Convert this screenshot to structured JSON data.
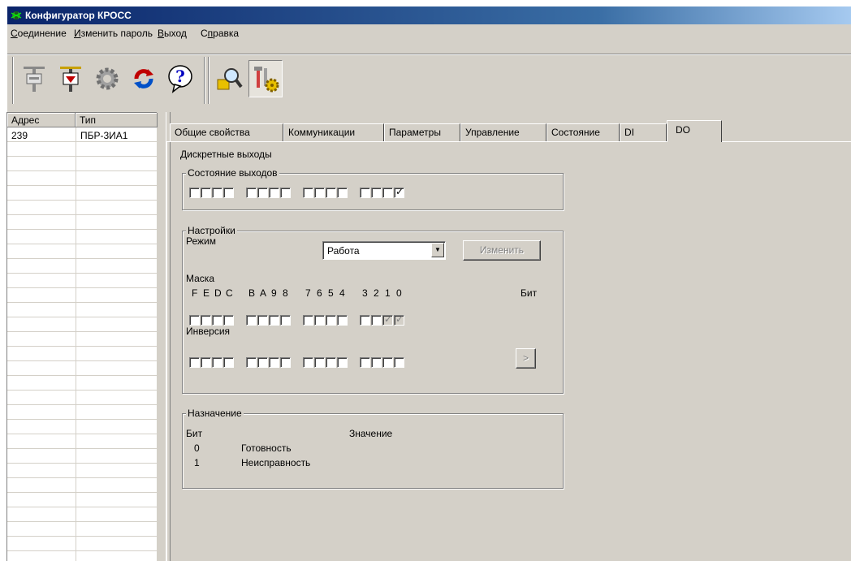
{
  "window": {
    "title": "Конфигуратор КРОСС"
  },
  "menu": [
    {
      "label": "Соединение",
      "underline": "С",
      "rest": "оединение"
    },
    {
      "label": "Изменить пароль",
      "underline": "И",
      "rest": "зменить пароль"
    },
    {
      "label": "Выход",
      "underline": "В",
      "rest": "ыход"
    },
    {
      "label": "Справка",
      "underline": "п",
      "prefix": "С",
      "rest": "равка"
    }
  ],
  "toolbar": {
    "buttons": [
      "connect-icon",
      "disconnect-icon",
      "settings-gear-icon",
      "refresh-icon",
      "help-icon",
      "search-device-icon",
      "tools-config-icon"
    ]
  },
  "device_list": {
    "columns": [
      "Адрес",
      "Тип"
    ],
    "rows": [
      {
        "address": "239",
        "type": "ПБР-3ИА1"
      }
    ]
  },
  "tabs": [
    "Общие свойства",
    "Коммуникации",
    "Параметры",
    "Управление",
    "Состояние",
    "DI",
    "DO"
  ],
  "active_tab": "DO",
  "do_panel": {
    "heading": "Дискретные выходы",
    "outputs_group": {
      "label": "Состояние выходов",
      "bits_checked": [
        false,
        false,
        false,
        false,
        false,
        false,
        false,
        false,
        false,
        false,
        false,
        false,
        false,
        false,
        false,
        true
      ]
    },
    "settings_group": {
      "label": "Настройки",
      "mode_label": "Режим",
      "mode_value": "Работа",
      "change_button": "Изменить",
      "mask_label": "Маска",
      "bit_letters": [
        "F",
        "E",
        "D",
        "C",
        "B",
        "A",
        "9",
        "8",
        "7",
        "6",
        "5",
        "4",
        "3",
        "2",
        "1",
        "0"
      ],
      "bit_word": "Бит",
      "mask_checked": [
        false,
        false,
        false,
        false,
        false,
        false,
        false,
        false,
        false,
        false,
        false,
        false,
        false,
        false,
        true,
        true
      ],
      "inversion_label": "Инверсия",
      "inversion_checked": [
        false,
        false,
        false,
        false,
        false,
        false,
        false,
        false,
        false,
        false,
        false,
        false,
        false,
        false,
        false,
        false
      ],
      "next_button": ">"
    },
    "assignment_group": {
      "label": "Назначение",
      "col_bit": "Бит",
      "col_value": "Значение",
      "rows": [
        {
          "bit": "0",
          "value": "Готовность"
        },
        {
          "bit": "1",
          "value": "Неисправность"
        }
      ]
    }
  },
  "colors": {
    "face": "#d4d0c8",
    "title_start": "#0a246a",
    "title_end": "#a6caf0"
  }
}
